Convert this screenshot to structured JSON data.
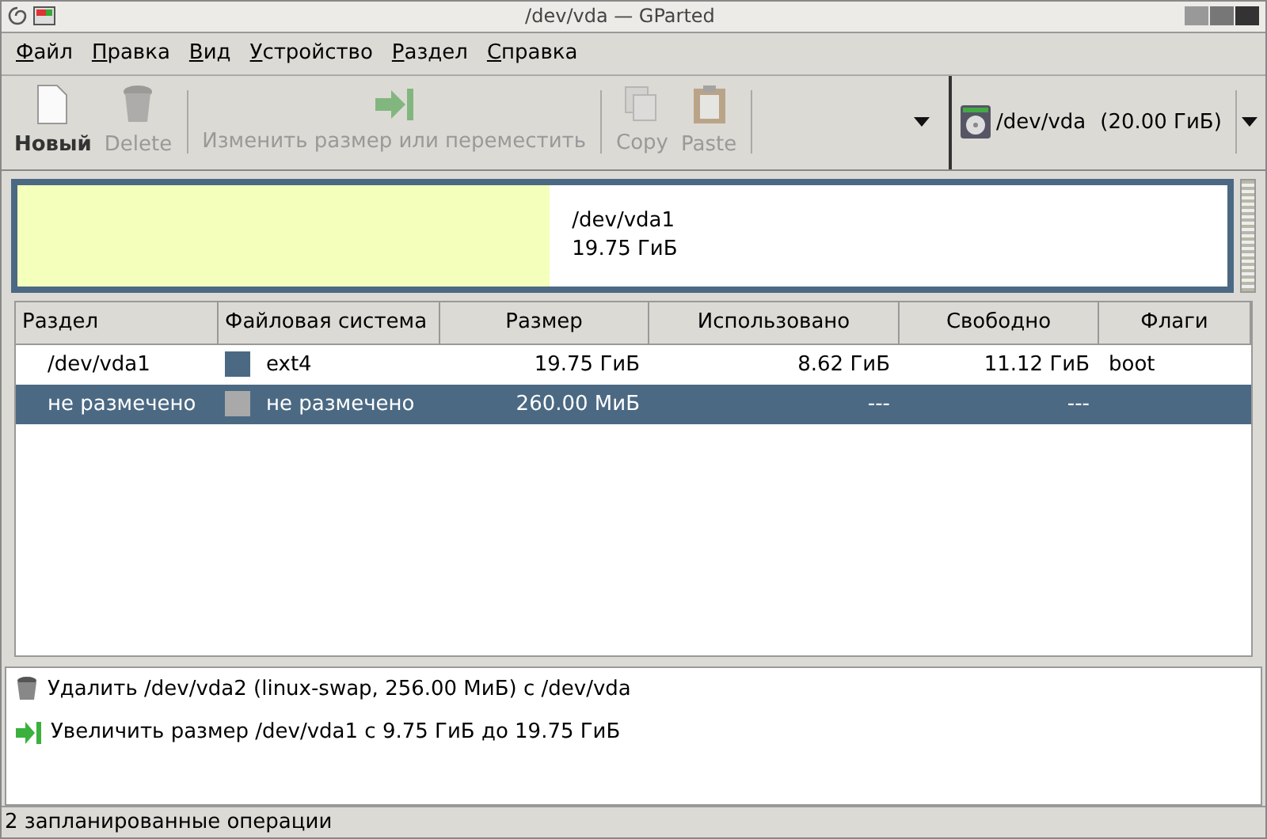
{
  "window": {
    "title": "/dev/vda — GParted"
  },
  "menu": [
    "Файл",
    "Правка",
    "Вид",
    "Устройство",
    "Раздел",
    "Справка"
  ],
  "toolbar": [
    {
      "kind": "new",
      "label": "Новый",
      "disabled": false
    },
    {
      "kind": "delete",
      "label": "Delete",
      "disabled": true
    },
    {
      "kind": "resize",
      "label": "Изменить размер или переместить",
      "disabled": true
    },
    {
      "kind": "copy",
      "label": "Copy",
      "disabled": true
    },
    {
      "kind": "paste",
      "label": "Paste",
      "disabled": true
    }
  ],
  "device": {
    "name": "/dev/vda",
    "size": "(20.00 ГиБ)"
  },
  "disk_map": {
    "partition": "/dev/vda1",
    "size": "19.75 ГиБ",
    "level": 0.44
  },
  "table": {
    "columns": [
      "Раздел",
      "Файловая система",
      "Размер",
      "Использовано",
      "Свободно",
      "Флаги"
    ],
    "rows": [
      {
        "partition": "/dev/vda1",
        "filesystem": "ext4",
        "color": "#4b6983",
        "size": "19.75 ГиБ",
        "used": "8.62 ГиБ",
        "free": "11.12 ГиБ",
        "flags": "boot",
        "selected": false
      },
      {
        "partition": "не размечено",
        "filesystem": "не размечено",
        "color": "#a9a9a9",
        "size": "260.00 МиБ",
        "used": "---",
        "free": "---",
        "flags": "",
        "selected": true
      }
    ]
  },
  "operations": [
    {
      "kind": "delete",
      "text": "Удалить /dev/vda2 (linux-swap, 256.00 МиБ) с /dev/vda"
    },
    {
      "kind": "resize",
      "text": "Увеличить размер /dev/vda1 с 9.75 ГиБ до 19.75 ГиБ"
    }
  ],
  "status_bar": "2 запланированные операции"
}
